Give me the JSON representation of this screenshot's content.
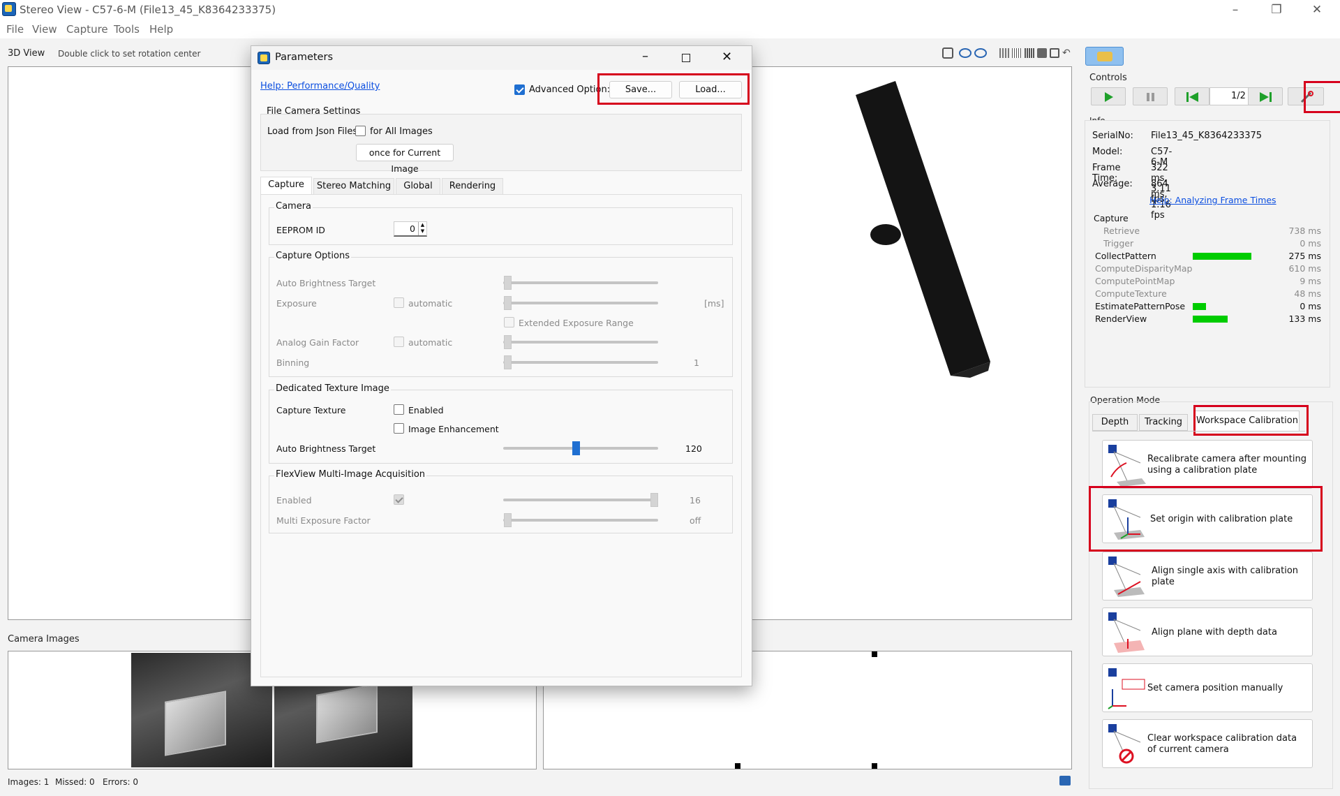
{
  "app": {
    "title": "Stereo View - C57-6-M (File13_45_K8364233375)",
    "menu": [
      "File",
      "View",
      "Capture",
      "Tools",
      "Help"
    ],
    "view_label": "3D View",
    "view_hint": "Double click to set rotation center",
    "camera_images_label": "Camera Images",
    "status": {
      "images": "Images:  1",
      "missed": "Missed:   0",
      "errors": "Errors:  0"
    }
  },
  "controls": {
    "label": "Controls",
    "page": "1/2"
  },
  "info": {
    "label": "Info",
    "rows": [
      {
        "k": "SerialNo:",
        "v": "File13_45_K8364233375"
      },
      {
        "k": "Model:",
        "v": "C57-6-M"
      },
      {
        "k": "Frame Time:",
        "v": "322 ms, 3.11 fps"
      },
      {
        "k": "Average:",
        "v": "864 ms, 1.16 fps"
      }
    ],
    "help_link": "Help: Analyzing Frame Times",
    "capture_label": "Capture",
    "timings": [
      {
        "name": "Retrieve",
        "ms": "738 ms",
        "active": false,
        "indent": true,
        "bar": 0
      },
      {
        "name": "Trigger",
        "ms": "0 ms",
        "active": false,
        "indent": true,
        "bar": 0
      },
      {
        "name": "CollectPattern",
        "ms": "275 ms",
        "active": true,
        "indent": false,
        "bar": 1.0
      },
      {
        "name": "ComputeDisparityMap",
        "ms": "610 ms",
        "active": false,
        "indent": false,
        "bar": 0
      },
      {
        "name": "ComputePointMap",
        "ms": "9 ms",
        "active": false,
        "indent": false,
        "bar": 0
      },
      {
        "name": "ComputeTexture",
        "ms": "48 ms",
        "active": false,
        "indent": false,
        "bar": 0
      },
      {
        "name": "EstimatePatternPose",
        "ms": "0 ms",
        "active": true,
        "indent": false,
        "bar": 0.23
      },
      {
        "name": "RenderView",
        "ms": "133 ms",
        "active": true,
        "indent": false,
        "bar": 0.6
      }
    ]
  },
  "operation_mode": {
    "label": "Operation Mode",
    "tabs": [
      "Depth",
      "Tracking",
      "Workspace Calibration"
    ],
    "buttons": [
      "Recalibrate camera after mounting\nusing a calibration plate",
      "Set origin with calibration plate",
      "Align single axis with calibration plate",
      "Align plane with depth data",
      "Set camera position manually",
      "Clear workspace calibration data\nof current camera"
    ]
  },
  "dialog": {
    "title": "Parameters",
    "help_link": "Help: Performance/Quality",
    "advanced_label": "Advanced Option:",
    "save_label": "Save...",
    "load_label": "Load...",
    "file_camera": {
      "title": "File Camera Settings",
      "load_label": "Load from Json Files",
      "all_images": "for All Images",
      "once_button": "once for Current Image"
    },
    "tabs": [
      "Capture",
      "Stereo Matching",
      "Global",
      "Rendering"
    ],
    "camera": {
      "title": "Camera",
      "eeprom_label": "EEPROM ID",
      "eeprom_value": "0"
    },
    "capture_options": {
      "title": "Capture Options",
      "auto_brightness": "Auto Brightness Target",
      "exposure": "Exposure",
      "automatic": "automatic",
      "ms_unit": "[ms]",
      "extended": "Extended Exposure Range",
      "analog_gain": "Analog Gain Factor",
      "binning": "Binning",
      "binning_value": "1"
    },
    "texture": {
      "title": "Dedicated Texture Image",
      "capture_texture": "Capture Texture",
      "enabled": "Enabled",
      "enhancement": "Image Enhancement",
      "auto_brightness": "Auto Brightness Target",
      "brightness_value": "120",
      "brightness_fraction": 0.47
    },
    "flexview": {
      "title": "FlexView Multi-Image Acquisition",
      "enabled": "Enabled",
      "enabled_value": "16",
      "multi_exposure": "Multi Exposure Factor",
      "multi_value": "off"
    }
  }
}
